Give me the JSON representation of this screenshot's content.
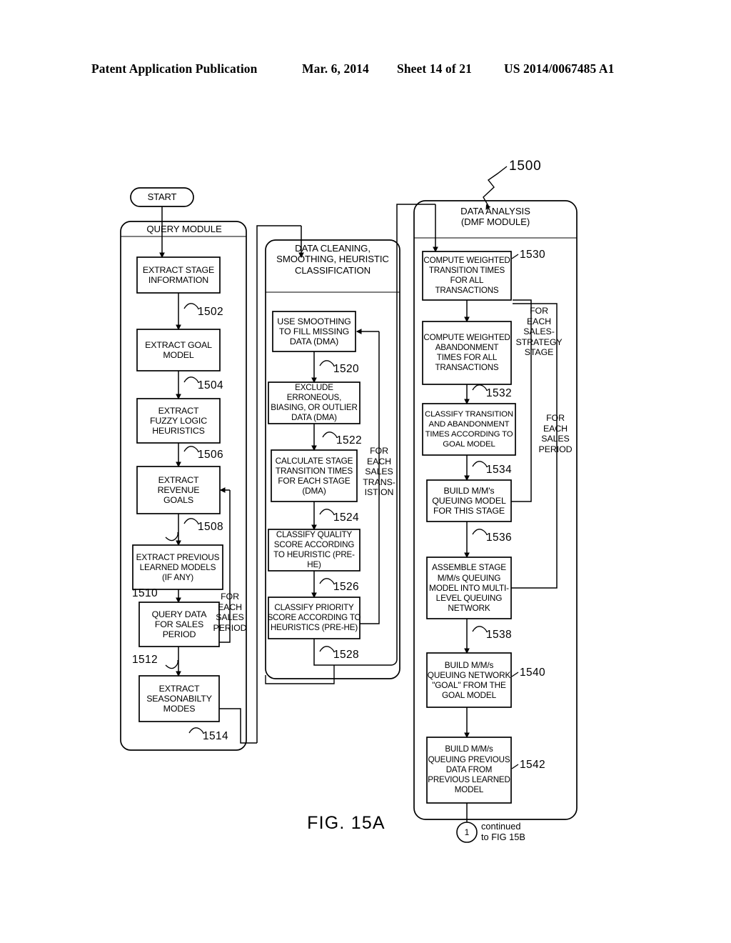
{
  "header": {
    "title": "Patent Application Publication",
    "date": "Mar. 6, 2014",
    "sheet": "Sheet 14 of 21",
    "number": "US 2014/0067485 A1"
  },
  "figure": {
    "caption": "FIG. 15A",
    "overall_ref": "1500"
  },
  "start_node": {
    "label": "START"
  },
  "modules": [
    {
      "name": "query-module",
      "title": "QUERY MODULE",
      "loop_label": "FOR\nEACH\nSALES\nPERIOD",
      "steps": [
        {
          "ref": "1502",
          "label": "EXTRACT STAGE\nINFORMATION"
        },
        {
          "ref": "1504",
          "label": "EXTRACT GOAL\nMODEL"
        },
        {
          "ref": "1506",
          "label": "EXTRACT\nFUZZY LOGIC\nHEURISTICS"
        },
        {
          "ref": "1508",
          "label": "EXTRACT\nREVENUE\nGOALS"
        },
        {
          "ref": "1510",
          "label": "EXTRACT PREVIOUS\nLEARNED MODELS\n(IF ANY)"
        },
        {
          "ref": "1512",
          "label": "QUERY DATA\nFOR SALES\nPERIOD"
        },
        {
          "ref": "1514",
          "label": "EXTRACT\nSEASONABILTY\nMODES"
        }
      ]
    },
    {
      "name": "data-cleaning-module",
      "title": "DATA CLEANING,\nSMOOTHING, HEURISTIC\nCLASSIFICATION",
      "loop_label": "FOR\nEACH\nSALES\nTRANS-\nISTION",
      "steps": [
        {
          "ref": "1520",
          "label": "USE SMOOTHING\nTO FILL MISSING\nDATA (DMA)"
        },
        {
          "ref": "1522",
          "label": "EXCLUDE ERRONEOUS,\nBIASING, OR OUTLIER\nDATA (DMA)"
        },
        {
          "ref": "1524",
          "label": "CALCULATE STAGE\nTRANSITION TIMES\nFOR EACH STAGE\n(DMA)"
        },
        {
          "ref": "1526",
          "label": "CLASSIFY QUALITY\nSCORE ACCORDING\nTO HEURISTIC (PRE-HE)"
        },
        {
          "ref": "1528",
          "label": "CLASSIFY PRIORITY\nSCORE ACCORDING TO\nHEURISTICS (PRE-HE)"
        }
      ]
    },
    {
      "name": "data-analysis-module",
      "title": "DATA ANALYSIS\n(DMF MODULE)",
      "loop_label_inner": "FOR\nEACH\nSALES-\nSTRATEGY\nSTAGE",
      "loop_label_outer": "FOR\nEACH\nSALES\nPERIOD",
      "steps": [
        {
          "ref": "1530",
          "label": "COMPUTE WEIGHTED\nTRANSITION TIMES\nFOR ALL\nTRANSACTIONS"
        },
        {
          "ref": "1532",
          "label": "COMPUTE WEIGHTED\nABANDONMENT\nTIMES FOR ALL\nTRANSACTIONS"
        },
        {
          "ref": "1534",
          "label": "CLASSIFY TRANSITION\nAND ABANDONMENT\nTIMES ACCORDING TO\nGOAL MODEL"
        },
        {
          "ref": "1536",
          "label": "BUILD M/M's\nQUEUING MODEL\nFOR THIS STAGE"
        },
        {
          "ref": "1538",
          "label": "ASSEMBLE STAGE\nM/M/s QUEUING\nMODEL INTO MULTI-\nLEVEL QUEUING\nNETWORK"
        },
        {
          "ref": "1540",
          "label": "BUILD M/M/s\nQUEUING NETWORK\n\"GOAL\" FROM THE\nGOAL MODEL"
        },
        {
          "ref": "1542",
          "label": "BUILD M/M/s\nQUEUING PREVIOUS\nDATA FROM\nPREVIOUS LEARNED\nMODEL"
        }
      ]
    }
  ],
  "continuation": {
    "circle_label": "1",
    "text": "continued\nto FIG 15B"
  },
  "colors": {
    "ink": "#000000",
    "paper": "#ffffff"
  }
}
